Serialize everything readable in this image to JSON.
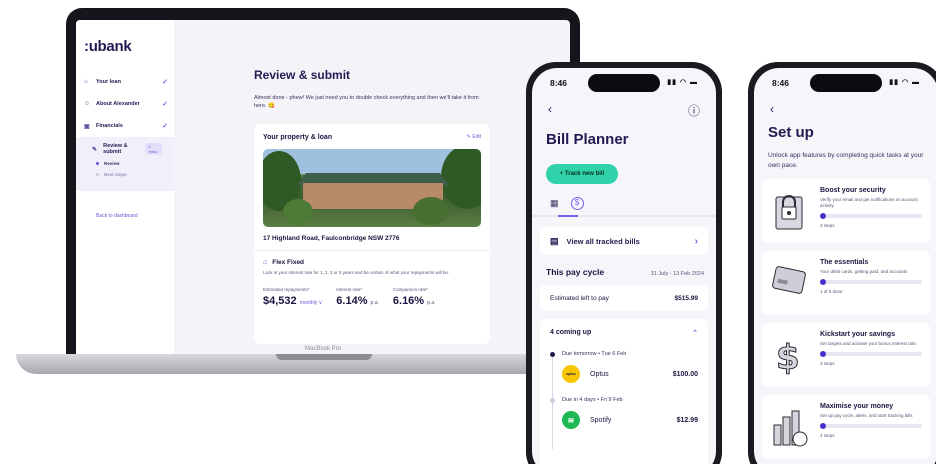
{
  "laptop": {
    "brand": "MacBook Pro",
    "logo": ":ubank",
    "nav": [
      {
        "label": "Your loan",
        "icon": "home-icon"
      },
      {
        "label": "About Alexander",
        "icon": "person-icon"
      },
      {
        "label": "Financials",
        "icon": "wallet-icon"
      }
    ],
    "active_step": {
      "label": "Review & submit",
      "badge": "2 mins",
      "substeps": [
        "Review",
        "Next steps"
      ]
    },
    "back_link": "Back to dashboard",
    "title": "Review & submit",
    "intro": "Almost done - phew! We just need you to double check everything and then we'll take it from here. 😋",
    "card": {
      "title": "Your property & loan",
      "edit": "Edit",
      "address": "17 Highland Road, Faulconbridge NSW 2776",
      "loan_title": "Flex Fixed",
      "loan_desc": "Lock in your interest rate for 1, 2, 3 or 5 years and be certain of what your repayments will be.",
      "metrics": [
        {
          "label": "Estimated repayments*",
          "value": "$4,532",
          "unit": "monthly ∨"
        },
        {
          "label": "Interest rate*",
          "value": "6.14%",
          "unit": "p.a."
        },
        {
          "label": "Comparison rate*",
          "value": "6.16%",
          "unit": "p.a."
        }
      ]
    }
  },
  "phone1": {
    "time": "8:46",
    "title": "Bill Planner",
    "track_button": "Track new bill",
    "view_all": "View all tracked bills",
    "cycle_title": "This pay cycle",
    "cycle_dates": "31 July - 13 Feb 2024",
    "left_to_pay_label": "Estimated left to pay",
    "left_to_pay_value": "$515.99",
    "coming_up": "4 coming up",
    "bills": [
      {
        "due": "Due tomorrow  •  Tue 6 Feb",
        "name": "Optus",
        "amount": "$100.00",
        "logo_text": "optus",
        "color": "#f7c600"
      },
      {
        "due": "Due in 4 days  •  Fri 9 Feb",
        "name": "Spotify",
        "amount": "$12.99",
        "logo_text": "",
        "color": "#1db954"
      }
    ]
  },
  "phone2": {
    "time": "8:46",
    "title": "Set up",
    "subtitle": "Unlock app features by completing quick tasks at your own pace.",
    "features": [
      {
        "title": "Boost your security",
        "desc": "Verify your email and get notifications on account activity.",
        "steps": "2 steps",
        "icon": "padlock-icon"
      },
      {
        "title": "The essentials",
        "desc": "Your debit cards, getting paid, and accounts",
        "steps": "1 of 6 done",
        "icon": "card-icon"
      },
      {
        "title": "Kickstart your savings",
        "desc": "Set targets and activate your bonus interest rate.",
        "steps": "3 steps",
        "icon": "dollar-icon"
      },
      {
        "title": "Maximise your money",
        "desc": "Set up pay cycle, alerts, and start tracking bills",
        "steps": "4 steps",
        "icon": "chart-icon"
      }
    ]
  }
}
